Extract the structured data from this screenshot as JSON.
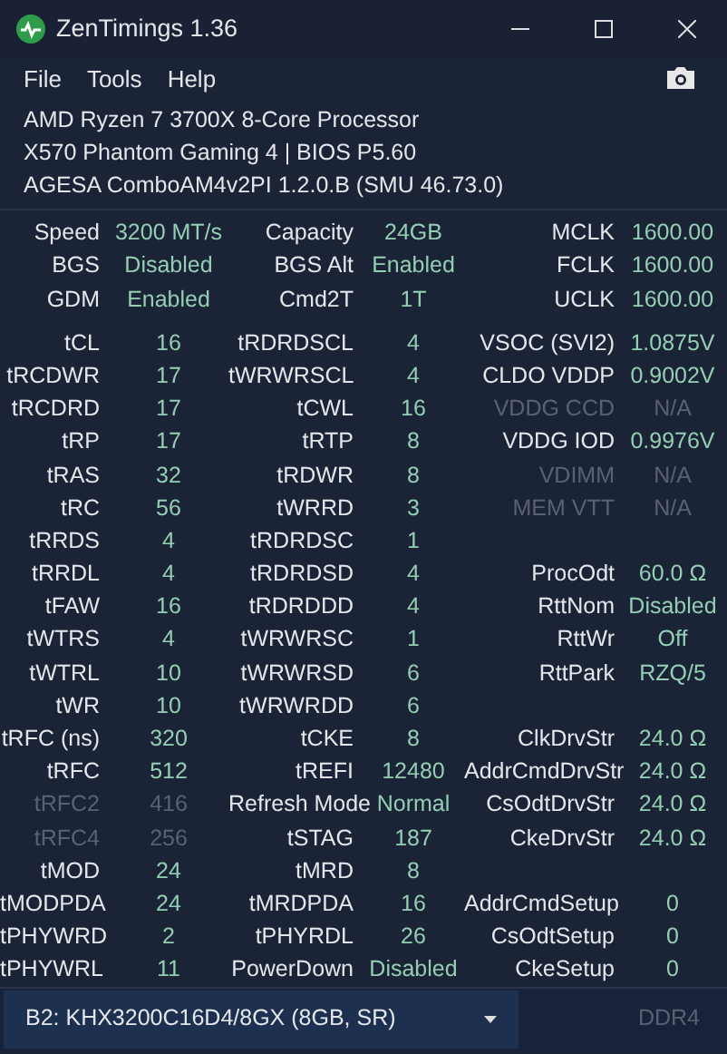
{
  "window": {
    "title": "ZenTimings 1.36"
  },
  "menu": [
    "File",
    "Tools",
    "Help"
  ],
  "system_info": [
    "AMD Ryzen 7 3700X 8-Core Processor",
    "X570 Phantom Gaming 4 | BIOS P5.60",
    "AGESA ComboAM4v2PI 1.2.0.B (SMU 46.73.0)"
  ],
  "summary_rows": [
    [
      {
        "label": "Speed",
        "value": "3200 MT/s",
        "disabled": false
      },
      {
        "label": "Capacity",
        "value": "24GB",
        "disabled": false
      },
      {
        "label": "MCLK",
        "value": "1600.00",
        "disabled": false
      }
    ],
    [
      {
        "label": "BGS",
        "value": "Disabled",
        "disabled": false
      },
      {
        "label": "BGS Alt",
        "value": "Enabled",
        "disabled": false
      },
      {
        "label": "FCLK",
        "value": "1600.00",
        "disabled": false
      }
    ],
    [
      {
        "label": "GDM",
        "value": "Enabled",
        "disabled": false
      },
      {
        "label": "Cmd2T",
        "value": "1T",
        "disabled": false
      },
      {
        "label": "UCLK",
        "value": "1600.00",
        "disabled": false
      }
    ]
  ],
  "timing_rows": [
    [
      {
        "label": "tCL",
        "value": "16",
        "disabled": false
      },
      {
        "label": "tRDRDSCL",
        "value": "4",
        "disabled": false
      },
      {
        "label": "VSOC (SVI2)",
        "value": "1.0875V",
        "disabled": false
      }
    ],
    [
      {
        "label": "tRCDWR",
        "value": "17",
        "disabled": false
      },
      {
        "label": "tWRWRSCL",
        "value": "4",
        "disabled": false
      },
      {
        "label": "CLDO VDDP",
        "value": "0.9002V",
        "disabled": false
      }
    ],
    [
      {
        "label": "tRCDRD",
        "value": "17",
        "disabled": false
      },
      {
        "label": "tCWL",
        "value": "16",
        "disabled": false
      },
      {
        "label": "VDDG CCD",
        "value": "N/A",
        "disabled": true
      }
    ],
    [
      {
        "label": "tRP",
        "value": "17",
        "disabled": false
      },
      {
        "label": "tRTP",
        "value": "8",
        "disabled": false
      },
      {
        "label": "VDDG IOD",
        "value": "0.9976V",
        "disabled": false
      }
    ],
    [
      {
        "label": "tRAS",
        "value": "32",
        "disabled": false
      },
      {
        "label": "tRDWR",
        "value": "8",
        "disabled": false
      },
      {
        "label": "VDIMM",
        "value": "N/A",
        "disabled": true
      }
    ],
    [
      {
        "label": "tRC",
        "value": "56",
        "disabled": false
      },
      {
        "label": "tWRRD",
        "value": "3",
        "disabled": false
      },
      {
        "label": "MEM VTT",
        "value": "N/A",
        "disabled": true
      }
    ],
    [
      {
        "label": "tRRDS",
        "value": "4",
        "disabled": false
      },
      {
        "label": "tRDRDSC",
        "value": "1",
        "disabled": false
      },
      null
    ],
    [
      {
        "label": "tRRDL",
        "value": "4",
        "disabled": false
      },
      {
        "label": "tRDRDSD",
        "value": "4",
        "disabled": false
      },
      {
        "label": "ProcOdt",
        "value": "60.0 Ω",
        "disabled": false
      }
    ],
    [
      {
        "label": "tFAW",
        "value": "16",
        "disabled": false
      },
      {
        "label": "tRDRDDD",
        "value": "4",
        "disabled": false
      },
      {
        "label": "RttNom",
        "value": "Disabled",
        "disabled": false
      }
    ],
    [
      {
        "label": "tWTRS",
        "value": "4",
        "disabled": false
      },
      {
        "label": "tWRWRSC",
        "value": "1",
        "disabled": false
      },
      {
        "label": "RttWr",
        "value": "Off",
        "disabled": false
      }
    ],
    [
      {
        "label": "tWTRL",
        "value": "10",
        "disabled": false
      },
      {
        "label": "tWRWRSD",
        "value": "6",
        "disabled": false
      },
      {
        "label": "RttPark",
        "value": "RZQ/5",
        "disabled": false
      }
    ],
    [
      {
        "label": "tWR",
        "value": "10",
        "disabled": false
      },
      {
        "label": "tWRWRDD",
        "value": "6",
        "disabled": false
      },
      null
    ],
    [
      {
        "label": "tRFC (ns)",
        "value": "320",
        "disabled": false
      },
      {
        "label": "tCKE",
        "value": "8",
        "disabled": false
      },
      {
        "label": "ClkDrvStr",
        "value": "24.0 Ω",
        "disabled": false
      }
    ],
    [
      {
        "label": "tRFC",
        "value": "512",
        "disabled": false
      },
      {
        "label": "tREFI",
        "value": "12480",
        "disabled": false
      },
      {
        "label": "AddrCmdDrvStr",
        "value": "24.0 Ω",
        "disabled": false
      }
    ],
    [
      {
        "label": "tRFC2",
        "value": "416",
        "disabled": true
      },
      {
        "label": "Refresh Mode",
        "value": "Normal",
        "disabled": false
      },
      {
        "label": "CsOdtDrvStr",
        "value": "24.0 Ω",
        "disabled": false
      }
    ],
    [
      {
        "label": "tRFC4",
        "value": "256",
        "disabled": true
      },
      {
        "label": "tSTAG",
        "value": "187",
        "disabled": false
      },
      {
        "label": "CkeDrvStr",
        "value": "24.0 Ω",
        "disabled": false
      }
    ],
    [
      {
        "label": "tMOD",
        "value": "24",
        "disabled": false
      },
      {
        "label": "tMRD",
        "value": "8",
        "disabled": false
      },
      null
    ],
    [
      {
        "label": "tMODPDA",
        "value": "24",
        "disabled": false
      },
      {
        "label": "tMRDPDA",
        "value": "16",
        "disabled": false
      },
      {
        "label": "AddrCmdSetup",
        "value": "0",
        "disabled": false
      }
    ],
    [
      {
        "label": "tPHYWRD",
        "value": "2",
        "disabled": false
      },
      {
        "label": "tPHYRDL",
        "value": "26",
        "disabled": false
      },
      {
        "label": "CsOdtSetup",
        "value": "0",
        "disabled": false
      }
    ],
    [
      {
        "label": "tPHYWRL",
        "value": "11",
        "disabled": false
      },
      {
        "label": "PowerDown",
        "value": "Disabled",
        "disabled": false
      },
      {
        "label": "CkeSetup",
        "value": "0",
        "disabled": false
      }
    ]
  ],
  "footer": {
    "module_select": "B2: KHX3200C16D4/8GX (8GB, SR)",
    "memory_type": "DDR4"
  }
}
